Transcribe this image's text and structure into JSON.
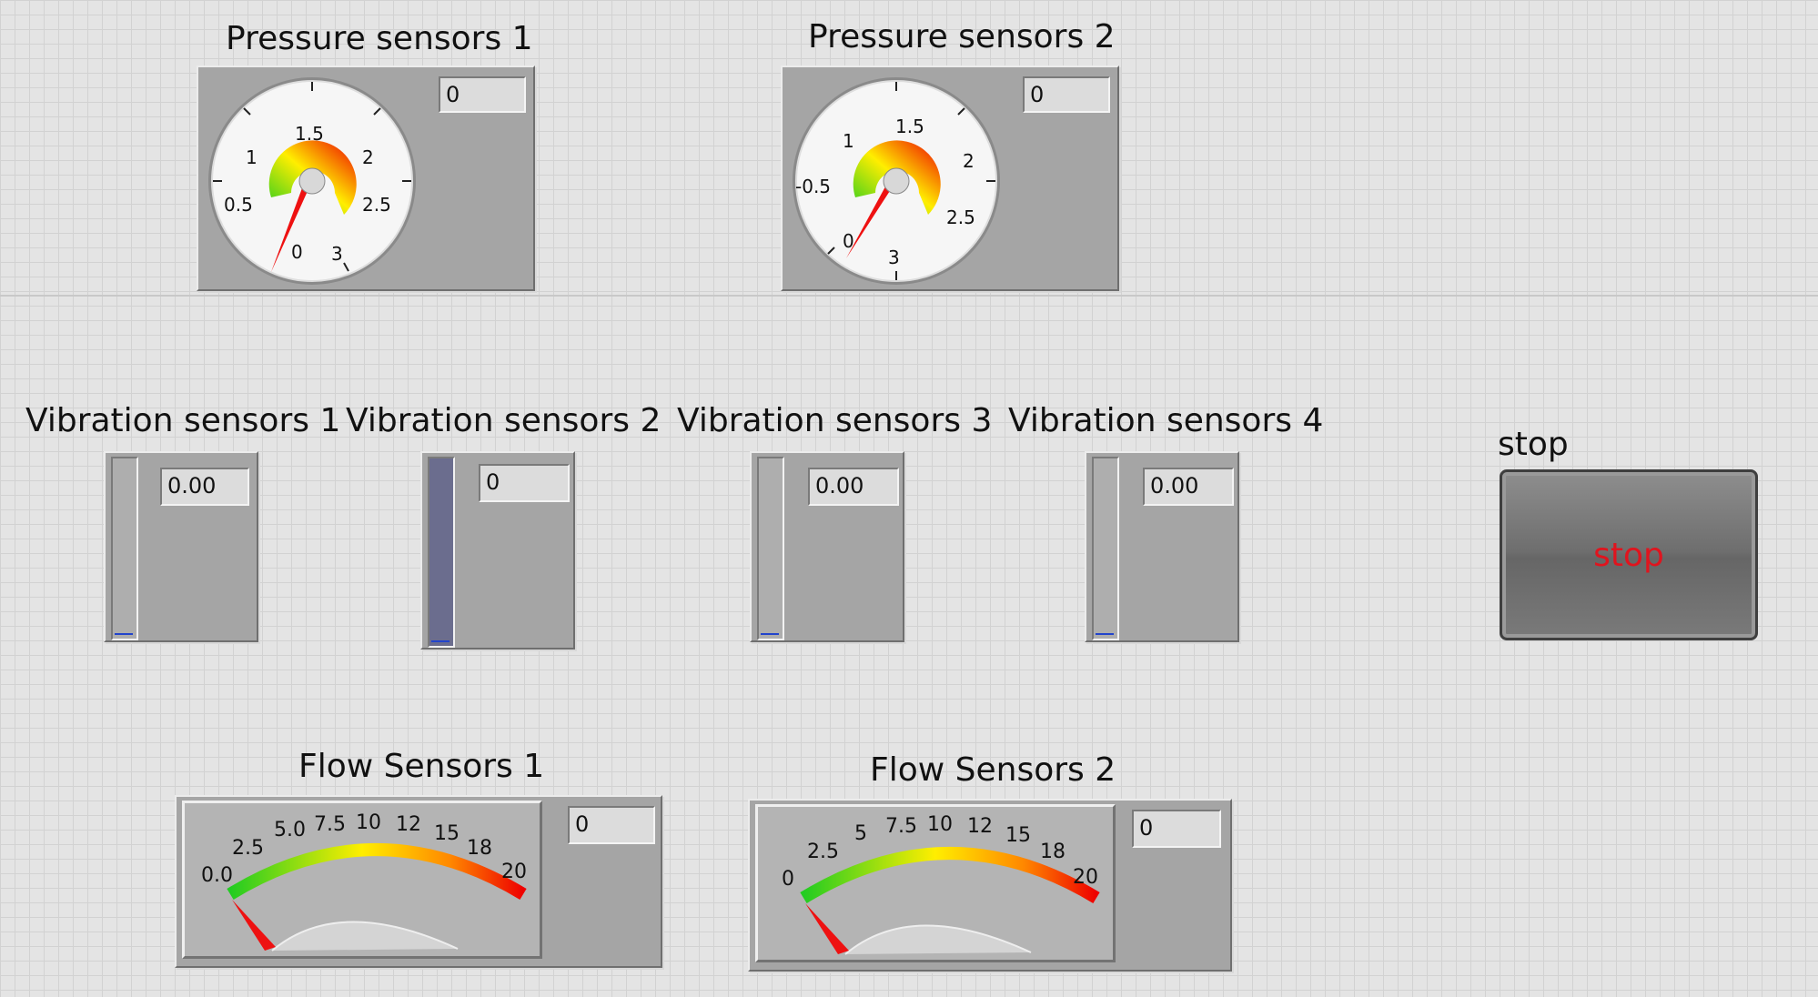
{
  "pressure_sensors": [
    {
      "label": "Pressure sensors 1",
      "value": "0",
      "ticks": [
        "0",
        "0.5",
        "1",
        "1.5",
        "2",
        "2.5",
        "3"
      ]
    },
    {
      "label": "Pressure sensors 2",
      "value": "0",
      "ticks": [
        "0",
        "-0.5",
        "1",
        "1.5",
        "2",
        "2.5",
        "3"
      ]
    }
  ],
  "vibration_sensors": [
    {
      "label": "Vibration sensors 1",
      "value": "0.00"
    },
    {
      "label": "Vibration sensors 2",
      "value": "0"
    },
    {
      "label": "Vibration sensors 3",
      "value": "0.00"
    },
    {
      "label": "Vibration sensors 4",
      "value": "0.00"
    }
  ],
  "flow_sensors": [
    {
      "label": "Flow Sensors 1",
      "value": "0",
      "ticks": [
        "0.0",
        "2.5",
        "5.0",
        "7.5",
        "10",
        "12",
        "15",
        "18",
        "20"
      ]
    },
    {
      "label": "Flow Sensors 2",
      "value": "0",
      "ticks": [
        "0",
        "2.5",
        "5",
        "7.5",
        "10",
        "12",
        "15",
        "18",
        "20"
      ]
    }
  ],
  "stop": {
    "label": "stop",
    "button_text": "stop",
    "text_color": "#e0141e"
  },
  "colors": {
    "gauge_green": "#22cc22",
    "gauge_yellow": "#ffee00",
    "gauge_red": "#ee0000",
    "needle": "#ee0000",
    "panel": "#a5a5a5"
  }
}
